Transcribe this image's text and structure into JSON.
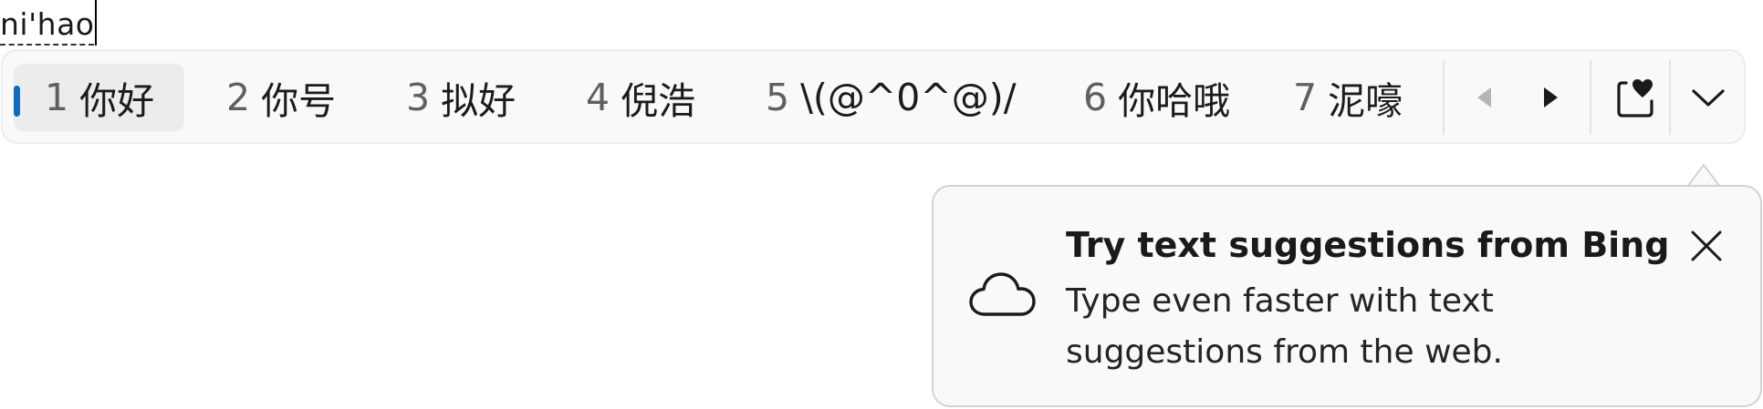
{
  "composition": {
    "text": "ni'hao"
  },
  "candidates": [
    {
      "num": "1",
      "text": "你好"
    },
    {
      "num": "2",
      "text": "你号"
    },
    {
      "num": "3",
      "text": "拟好"
    },
    {
      "num": "4",
      "text": "倪浩"
    },
    {
      "num": "5",
      "text": "\\(@^0^@)/"
    },
    {
      "num": "6",
      "text": "你哈哦"
    },
    {
      "num": "7",
      "text": "泥嚎"
    }
  ],
  "selected_index": 0,
  "controls": {
    "prev_page_icon": "triangle-left-icon",
    "next_page_icon": "triangle-right-icon",
    "emoji_icon": "heart-clipboard-icon",
    "expand_icon": "chevron-down-icon"
  },
  "flyout": {
    "icon": "cloud-icon",
    "title": "Try text suggestions from Bing",
    "body": "Type even faster with text suggestions from the web.",
    "close_icon": "close-icon"
  },
  "colors": {
    "accent": "#0f6cbd",
    "bar_background": "#f9f9f9",
    "selected_background": "#ececec"
  }
}
